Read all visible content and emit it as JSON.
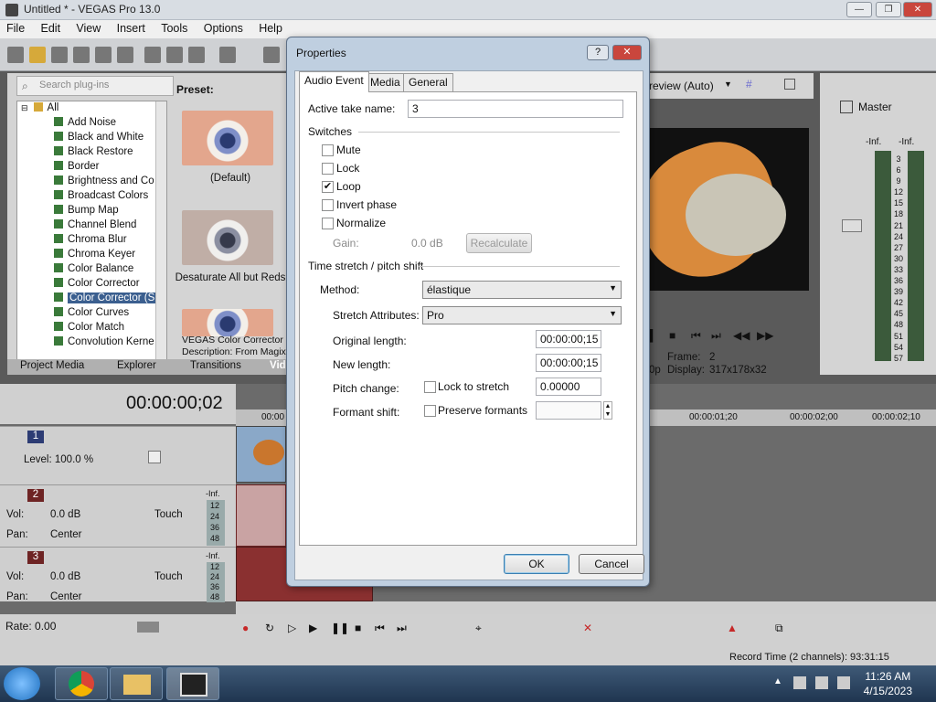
{
  "window": {
    "title": "Untitled * - VEGAS Pro 13.0"
  },
  "menu": [
    "File",
    "Edit",
    "View",
    "Insert",
    "Tools",
    "Options",
    "Help"
  ],
  "plugins": {
    "search_placeholder": "Search plug-ins",
    "preset_label": "Preset:",
    "tree": [
      "All",
      "Add Noise",
      "Black and White",
      "Black Restore",
      "Border",
      "Brightness and Co",
      "Broadcast Colors",
      "Bump Map",
      "Channel Blend",
      "Chroma Blur",
      "Chroma Keyer",
      "Color Balance",
      "Color Corrector",
      "Color Corrector (S",
      "Color Curves",
      "Color Match",
      "Convolution Kerne"
    ],
    "selected_index": 13,
    "presets": [
      "(Default)",
      "Desaturate All but Reds"
    ],
    "desc_line1": "VEGAS Color Corrector (S",
    "desc_line2": "Description: From Magix C"
  },
  "bottom_tabs": [
    "Project Media",
    "Explorer",
    "Transitions",
    "Vid"
  ],
  "preview": {
    "mode": "review (Auto)",
    "frame_label": "Frame:",
    "frame_value": "2",
    "display_label": "Display:",
    "display_value": "317x178x32",
    "left_fragment": "0p"
  },
  "master": {
    "label": "Master",
    "inf_left": "-Inf.",
    "inf_right": "-Inf.",
    "scale": [
      "3",
      "6",
      "9",
      "12",
      "15",
      "18",
      "21",
      "24",
      "27",
      "30",
      "33",
      "36",
      "39",
      "42",
      "45",
      "48",
      "51",
      "54",
      "57"
    ]
  },
  "timeline": {
    "time": "00:00:00;02",
    "ruler": [
      "00:00",
      "00:00:01;20",
      "00:00:02;00",
      "00:00:02;10"
    ],
    "tracks": [
      {
        "num": "1",
        "level_label": "Level: 100.0 %"
      },
      {
        "num": "2",
        "vol_label": "Vol:",
        "vol_value": "0.0 dB",
        "pan_label": "Pan:",
        "pan_value": "Center",
        "mode": "Touch",
        "inf": "-Inf.",
        "scale": [
          "12",
          "24",
          "36",
          "48"
        ]
      },
      {
        "num": "3",
        "vol_label": "Vol:",
        "vol_value": "0.0 dB",
        "pan_label": "Pan:",
        "pan_value": "Center",
        "mode": "Touch",
        "inf": "-Inf.",
        "scale": [
          "12",
          "24",
          "36",
          "48"
        ]
      }
    ],
    "rate": "Rate: 0.00",
    "record_time": "Record Time (2 channels): 93:31:15"
  },
  "taskbar": {
    "time": "11:26 AM",
    "date": "4/15/2023"
  },
  "dialog": {
    "title": "Properties",
    "help_btn": "?",
    "close_btn": "✕",
    "tabs": [
      "Audio Event",
      "Media",
      "General"
    ],
    "active_take_label": "Active take name:",
    "active_take_value": "3",
    "switches_label": "Switches",
    "switches": [
      {
        "label": "Mute",
        "checked": false
      },
      {
        "label": "Lock",
        "checked": false
      },
      {
        "label": "Loop",
        "checked": true
      },
      {
        "label": "Invert phase",
        "checked": false
      },
      {
        "label": "Normalize",
        "checked": false
      }
    ],
    "gain_label": "Gain:",
    "gain_value": "0.0 dB",
    "recalculate": "Recalculate",
    "stretch_section": "Time stretch / pitch shift",
    "method_label": "Method:",
    "method_value": "élastique",
    "stretch_attr_label": "Stretch Attributes:",
    "stretch_attr_value": "Pro",
    "orig_len_label": "Original length:",
    "orig_len_value": "00:00:00;15",
    "new_len_label": "New length:",
    "new_len_value": "00:00:00;15",
    "pitch_label": "Pitch change:",
    "lock_stretch": "Lock to stretch",
    "pitch_value": "0.00000",
    "formant_label": "Formant shift:",
    "preserve_formants": "Preserve formants",
    "ok": "OK",
    "cancel": "Cancel"
  },
  "colors": {
    "selection": "#3b5f8f",
    "dialog_frame": "#bfcfe0",
    "taskbar": "#2a4360"
  }
}
